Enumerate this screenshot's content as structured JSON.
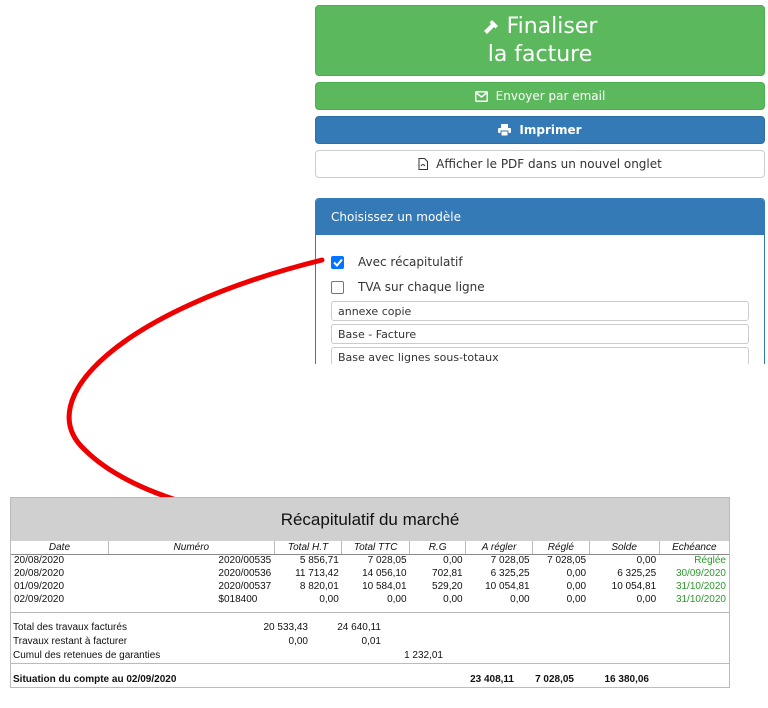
{
  "actions": {
    "finalize_line1": "Finaliser",
    "finalize_line2": "la facture",
    "email_label": "Envoyer par email",
    "print_label": "Imprimer",
    "pdf_label": "Afficher le PDF dans un nouvel onglet",
    "finalize_icon": "gavel-icon",
    "email_icon": "envelope-icon",
    "print_icon": "printer-icon",
    "pdf_icon": "file-pdf-icon"
  },
  "template_panel": {
    "title": "Choisissez un modèle",
    "options": [
      {
        "label": "Avec récapitulatif",
        "checked": true
      },
      {
        "label": "TVA sur chaque ligne",
        "checked": false
      }
    ],
    "templates": [
      "annexe copie",
      "Base - Facture",
      "Base avec lignes sous-totaux"
    ]
  },
  "recap": {
    "title": "Récapitulatif du marché",
    "columns": [
      "Date",
      "Numéro",
      "Total H.T",
      "Total TTC",
      "R.G",
      "A régler",
      "Réglé",
      "Solde",
      "Echéance"
    ],
    "rows": [
      [
        "20/08/2020",
        "2020/00535",
        "5 856,71",
        "7 028,05",
        "0,00",
        "7 028,05",
        "7 028,05",
        "0,00",
        "Réglée"
      ],
      [
        "20/08/2020",
        "2020/00536",
        "11 713,42",
        "14 056,10",
        "702,81",
        "6 325,25",
        "0,00",
        "6 325,25",
        "30/09/2020"
      ],
      [
        "01/09/2020",
        "2020/00537",
        "8 820,01",
        "10 584,01",
        "529,20",
        "10 054,81",
        "0,00",
        "10 054,81",
        "31/10/2020"
      ],
      [
        "02/09/2020",
        "$018400",
        "0,00",
        "0,00",
        "0,00",
        "0,00",
        "0,00",
        "0,00",
        "31/10/2020"
      ]
    ],
    "totals": {
      "travaux_factures_label": "Total des travaux facturés",
      "travaux_factures_ht": "20 533,43",
      "travaux_factures_ttc": "24 640,11",
      "restant_label": "Travaux restant à facturer",
      "restant_ht": "0,00",
      "restant_ttc": "0,01",
      "cumul_label": "Cumul des retenues de garanties",
      "cumul_rg": "1 232,01",
      "situation_label": "Situation du compte au 02/09/2020",
      "situation_a_regler": "23 408,11",
      "situation_regle": "7 028,05",
      "situation_solde": "16 380,06"
    }
  },
  "colors": {
    "success": "#5cb85c",
    "primary": "#337ab7",
    "arrow": "#ee0000",
    "paid_green": "#2a9a2a"
  }
}
